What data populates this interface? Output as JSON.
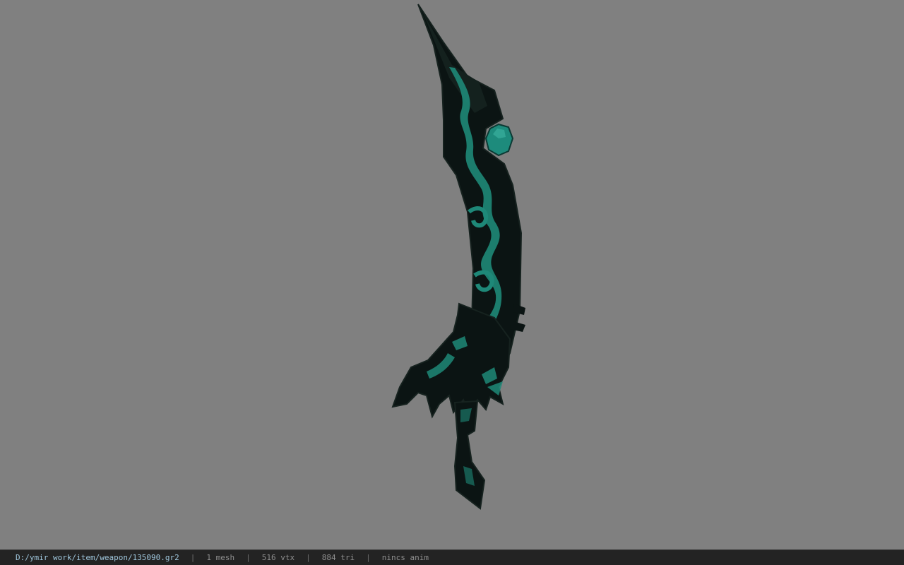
{
  "viewer": {
    "background_color": "#808080",
    "model_colors": {
      "dark": "#0b1413",
      "edge": "#16221f",
      "glow": "#1e8878",
      "gem": "#1d8b7c"
    }
  },
  "status": {
    "path": "D:/ymir work/item/weapon/135090.gr2",
    "separator": "|",
    "mesh": "1 mesh",
    "vertices": "516 vtx",
    "triangles": "884 tri",
    "anim": "nincs anim"
  }
}
